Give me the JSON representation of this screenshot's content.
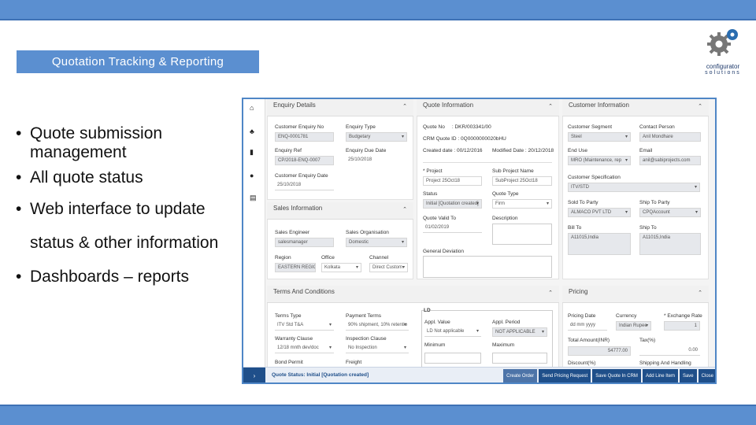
{
  "slide": {
    "title": "Quotation Tracking & Reporting",
    "logo": {
      "line1": "configurator",
      "line2": "solutions"
    },
    "bullets": [
      "Quote submission management",
      "All quote status",
      "Web interface to update status & other information",
      "Dashboards – reports"
    ]
  },
  "app": {
    "enquiry": {
      "title": "Enquiry Details",
      "cust_enq_no_label": "Customer Enquiry No",
      "cust_enq_no": "ENQ-0001781",
      "enq_type_label": "Enquiry Type",
      "enq_type": "Budgetary",
      "enq_ref_label": "Enquiry Ref",
      "enq_ref": "CP/2018-ENQ-0007",
      "enq_due_label": "Enquiry Due Date",
      "enq_due": "25/10/2018",
      "cust_enq_date_label": "Customer Enquiry Date",
      "cust_enq_date": "25/10/2018"
    },
    "sales": {
      "title": "Sales Information",
      "engineer_label": "Sales Engineer",
      "engineer": "salesmanager",
      "org_label": "Sales Organisation",
      "org": "Domestic",
      "region_label": "Region",
      "region": "EASTERN REGION",
      "office_label": "Office",
      "office": "Kolkata",
      "channel_label": "Channel",
      "channel": "Direct Custom"
    },
    "quote": {
      "title": "Quote Information",
      "quote_no_label": "Quote No",
      "quote_no": ": DKR/003341/00",
      "crm_label": "CRM Quote ID",
      "crm": ": 0Q0000000020bHU",
      "created_label": "Created date",
      "created": ": 00/12/2016",
      "modified_label": "Modified Date",
      "modified": ": 20/12/2018",
      "project_label": "* Project",
      "project": "Project 25Oct18",
      "subproject_label": "Sub Project Name",
      "subproject": "SubProject 25Oct18",
      "status_label": "Status",
      "status": "Initial [Quotation created]",
      "quote_type_label": "Quote Type",
      "quote_type": "Firm",
      "valid_label": "Quote Valid To",
      "valid": "01/02/2019",
      "desc_label": "Description",
      "deviation_label": "General Deviation"
    },
    "customer": {
      "title": "Customer Information",
      "segment_label": "Customer Segment",
      "segment": "Steel",
      "contact_label": "Contact Person",
      "contact": "Anil Mondhare",
      "end_use_label": "End Use",
      "end_use": "MRO (Maintenance, rep",
      "email_label": "Email",
      "email": "anil@sabiprojects.com",
      "spec_label": "Customer Specification",
      "spec": "ITV/STD",
      "sold_label": "Sold To Party",
      "sold": "ALMACO PVT LTD",
      "ship_party_label": "Ship To Party",
      "ship_party": "CPQAccount",
      "bill_label": "Bill To",
      "bill": "A11015,India",
      "ship_label": "Ship To",
      "ship": "A11015,India"
    },
    "terms": {
      "title": "Terms And Conditions",
      "terms_type_label": "Terms Type",
      "terms_type": "ITV Std T&A",
      "payment_label": "Payment Terms",
      "payment": "90% shipment, 10% retentio",
      "warranty_label": "Warranty Clause",
      "warranty": "12/18 mnth dev/doc",
      "inspection_label": "Inspection Clause",
      "inspection": "No Inspection",
      "bond_label": "Bond Permit",
      "freight_label": "Freight",
      "ld_title": "LD",
      "appl_value_label": "Appl. Value",
      "appl_value": "LD Not applicable",
      "appl_period_label": "Appl. Period",
      "appl_period": "NOT APPLICABLE",
      "min_label": "Minimum",
      "max_label": "Maximum"
    },
    "pricing": {
      "title": "Pricing",
      "date_label": "Pricing Date",
      "date": "dd mm yyyy",
      "currency_label": "Currency",
      "currency": "Indian Rupee",
      "rate_label": "* Exchange Rate",
      "rate": "1",
      "total_label": "Total Amount(INR)",
      "total": "54777.00",
      "tax_label": "Tax(%)",
      "tax": "0.00",
      "discount_label": "Discount(%)",
      "shipping_label": "Shipping And Handling"
    },
    "status_bar": {
      "text": "Quote Status: Initial [Quotation created]",
      "buttons": [
        "Create Order",
        "Send Pricing Request",
        "Save Quote In CRM",
        "Add Line Item",
        "Save",
        "Close"
      ]
    }
  }
}
